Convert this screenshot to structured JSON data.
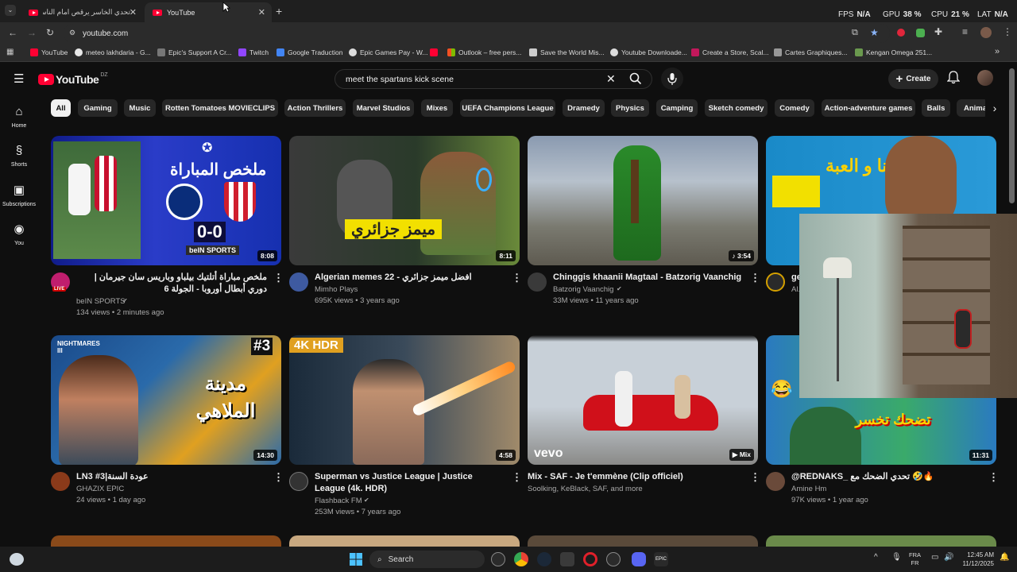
{
  "browser": {
    "tabs": [
      {
        "title": "تحدي الخاسر يرقص امام الناس مع..."
      },
      {
        "title": "YouTube"
      }
    ],
    "new_tab": "+",
    "stats": {
      "fps_label": "FPS",
      "fps": "N/A",
      "gpu_label": "GPU",
      "gpu": "38 %",
      "cpu_label": "CPU",
      "cpu": "21 %",
      "lat_label": "LAT",
      "lat": "N/A"
    },
    "url": "youtube.com",
    "bookmarks": [
      {
        "label": "YouTube",
        "color": "#ff0033"
      },
      {
        "label": "meteo lakhdaria - G...",
        "color": "#e8e8e8"
      },
      {
        "label": "Epic's Support A Cr...",
        "color": "#bbbbbb"
      },
      {
        "label": "Twitch",
        "color": "#9146ff"
      },
      {
        "label": "Google Traduction",
        "color": "#4285f4"
      },
      {
        "label": "Epic Games Pay - W...",
        "color": "#dddddd"
      },
      {
        "label": "",
        "color": "#ff0033"
      },
      {
        "label": "Outlook – free pers...",
        "color": "#f25022"
      },
      {
        "label": "Save the World Mis...",
        "color": "#cccccc"
      },
      {
        "label": "Youtube Downloade...",
        "color": "#dddddd"
      },
      {
        "label": "Create a Store, Scal...",
        "color": "#c2185b"
      },
      {
        "label": "Cartes Graphiques...",
        "color": "#999999"
      },
      {
        "label": "Kengan Omega 251...",
        "color": "#6a994e"
      }
    ]
  },
  "youtube": {
    "logo_text": "YouTube",
    "country": "DZ",
    "search_query": "meet the spartans kick scene",
    "create_label": "Create",
    "sidebar": [
      {
        "label": "Home"
      },
      {
        "label": "Shorts"
      },
      {
        "label": "Subscriptions"
      },
      {
        "label": "You"
      }
    ],
    "chips": [
      "All",
      "Gaming",
      "Music",
      "Rotten Tomatoes MOVIECLIPS",
      "Action Thrillers",
      "Marvel Studios",
      "Mixes",
      "UEFA Champions League",
      "Dramedy",
      "Physics",
      "Camping",
      "Sketch comedy",
      "Comedy",
      "Action-adventure games",
      "Balls",
      "Animat"
    ],
    "videos": [
      {
        "title": "ملخص مباراة أتلتيك بيلباو وباريس سان جيرمان | دوري أبطال أوروبا - الجولة 6",
        "channel": "beIN SPORTS",
        "meta": "134 views • 2 minutes ago",
        "duration": "8:08",
        "thumb_text": "ملخص المباراة",
        "score": "0-0",
        "live": "LIVE"
      },
      {
        "title": "Algerian memes 22 - افضل ميمز جزائري",
        "channel": "Mimho Plays",
        "meta": "695K views • 3 years ago",
        "duration": "8:11",
        "thumb_text": "ميمز جزائري"
      },
      {
        "title": "Chinggis khaanii Magtaal - Batzorig Vaanchig",
        "channel": "Batzorig Vaanchig",
        "meta": "33M views • 11 years ago",
        "duration": "3:54"
      },
      {
        "title": "ge...",
        "channel": "Al...",
        "meta": "",
        "duration": "",
        "thumb_text": "انا و العبة"
      },
      {
        "title": "LN3 #3|عودة السنة",
        "channel": "GHAZIX EPIC",
        "meta": "24 views • 1 day ago",
        "duration": "14:30",
        "thumb_text": "مدينة الملاهي",
        "badge": "#3"
      },
      {
        "title": "Superman vs Justice League  | Justice League (4k. HDR)",
        "channel": "Flashback FM",
        "meta": "253M views • 7 years ago",
        "duration": "4:58",
        "badge": "4K HDR"
      },
      {
        "title": "Mix - SAF - Je t'emmène (Clip officiel)",
        "channel": "Soolking, KeBlack, SAF, and more",
        "meta": "",
        "duration": "Mix",
        "badge": "vevo"
      },
      {
        "title": "@REDNAKS_ تحدي الضحك مع 🤣🔥",
        "channel": "Amine Hm",
        "meta": "97K views • 1 year ago",
        "duration": "11:31",
        "thumb_text": "تضحك تخسر"
      }
    ]
  },
  "taskbar": {
    "search_label": "Search",
    "lang": "FRA",
    "lang2": "FR",
    "time": "12:45 AM",
    "date": "11/12/2025"
  },
  "colors": {
    "youtube_red": "#ff0033",
    "bg": "#0f0f0f",
    "chip": "#272727"
  }
}
